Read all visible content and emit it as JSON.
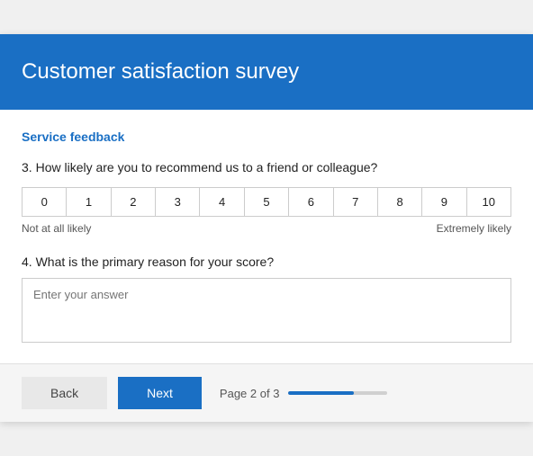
{
  "header": {
    "title": "Customer satisfaction survey"
  },
  "section": {
    "title": "Service feedback"
  },
  "questions": [
    {
      "number": "3.",
      "text": "How likely are you to recommend us to a friend or colleague?",
      "type": "likert",
      "scale": [
        "0",
        "1",
        "2",
        "3",
        "4",
        "5",
        "6",
        "7",
        "8",
        "9",
        "10"
      ],
      "label_left": "Not at all likely",
      "label_right": "Extremely likely"
    },
    {
      "number": "4.",
      "text": "What is the primary reason for your score?",
      "type": "textarea",
      "placeholder": "Enter your answer"
    }
  ],
  "footer": {
    "back_label": "Back",
    "next_label": "Next",
    "page_text": "Page 2 of 3",
    "progress_percent": 66
  }
}
